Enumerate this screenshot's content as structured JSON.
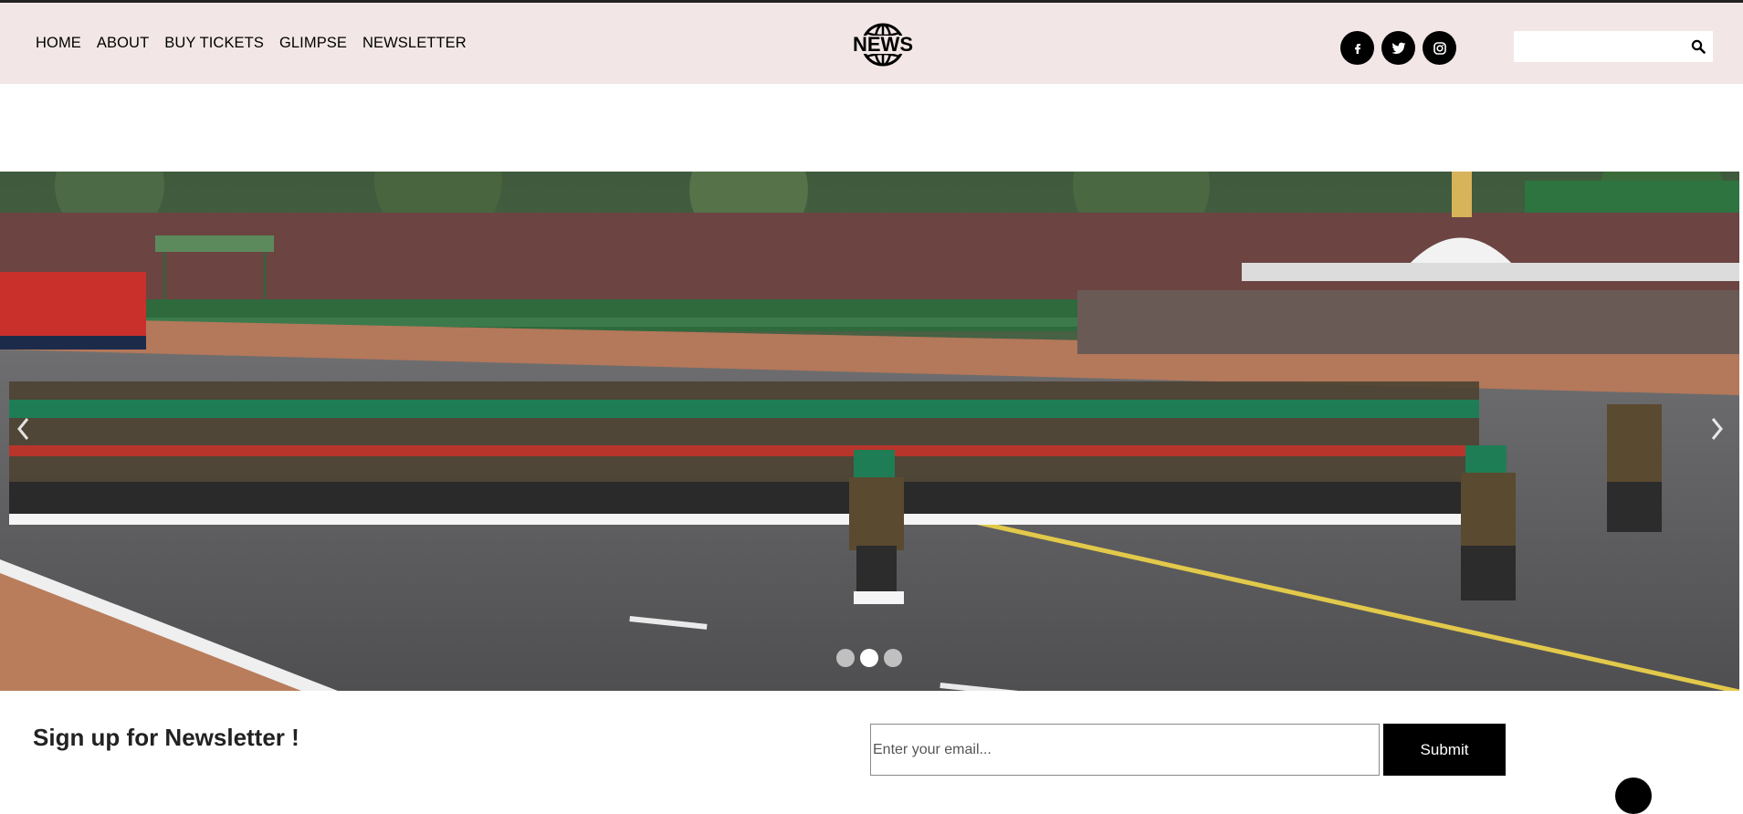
{
  "nav": {
    "items": [
      {
        "label": "HOME"
      },
      {
        "label": "ABOUT"
      },
      {
        "label": "BUY TICKETS"
      },
      {
        "label": "GLIMPSE"
      },
      {
        "label": "NEWSLETTER"
      }
    ]
  },
  "logo": {
    "text": "NEWS"
  },
  "social": {
    "icons": [
      "facebook-icon",
      "twitter-icon",
      "instagram-icon"
    ],
    "facebook_glyph": "f"
  },
  "search": {
    "placeholder": "",
    "value": ""
  },
  "hero": {
    "slides_count": 3,
    "active_slide": 2
  },
  "newsletter": {
    "title": "Sign up for Newsletter !",
    "email_placeholder": "Enter your email...",
    "submit_label": "Submit"
  },
  "colors": {
    "header_bg": "#f2e7e6",
    "button_bg": "#000000",
    "text": "#222222"
  }
}
